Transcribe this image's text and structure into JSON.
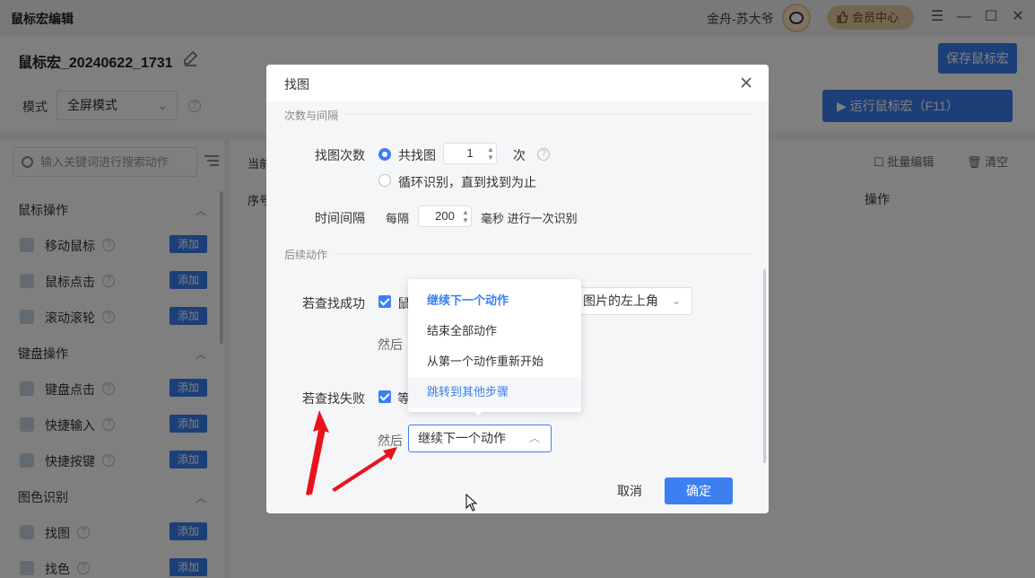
{
  "titlebar": {
    "app_title": "鼠标宏编辑",
    "user_name": "金舟-苏大爷",
    "vip_label": "会员中心",
    "controls": [
      "☰",
      "—",
      "☐",
      "✕"
    ]
  },
  "macro": {
    "name": "鼠标宏_20240622_1731",
    "save_label": "保存鼠标宏"
  },
  "mode": {
    "label": "模式",
    "value": "全屏模式",
    "run_label": "运行鼠标宏（F11）"
  },
  "sidebar": {
    "search_placeholder": "输入关键词进行搜索动作",
    "groups": [
      {
        "title": "鼠标操作",
        "items": [
          {
            "label": "移动鼠标",
            "icon": "mouse-move-icon"
          },
          {
            "label": "鼠标点击",
            "icon": "mouse-click-icon"
          },
          {
            "label": "滚动滚轮",
            "icon": "scroll-wheel-icon"
          }
        ]
      },
      {
        "title": "键盘操作",
        "items": [
          {
            "label": "键盘点击",
            "icon": "keyboard-icon"
          },
          {
            "label": "快捷输入",
            "icon": "quick-input-icon"
          },
          {
            "label": "快捷按键",
            "icon": "enter-key-icon"
          }
        ]
      },
      {
        "title": "图色识别",
        "items": [
          {
            "label": "找图",
            "icon": "image-icon"
          },
          {
            "label": "找色",
            "icon": "color-icon"
          }
        ]
      }
    ],
    "add_label": "添加"
  },
  "main": {
    "current_label": "当前",
    "seq_label": "序号",
    "batch_label": "批量编辑",
    "clear_label": "清空",
    "op_label": "操作"
  },
  "dialog": {
    "title": "找图",
    "section1": "次数与间隔",
    "find_count_label": "找图次数",
    "radio_total": "共找图",
    "count_value": "1",
    "times_unit": "次",
    "radio_loop": "循环识别，直到找到为止",
    "interval_label": "时间间隔",
    "every": "每隔",
    "interval_value": "200",
    "interval_unit": "毫秒 进行一次识别",
    "section2": "后续动作",
    "success_label": "若查找成功",
    "success_check_text": "鼠",
    "success_select": "图片的左上角",
    "then1": "然后",
    "fail_label": "若查找失败",
    "fail_check_text": "等",
    "then2": "然后",
    "fail_select": "继续下一个动作",
    "cancel": "取消",
    "ok": "确定"
  },
  "dropdown": {
    "options": [
      "继续下一个动作",
      "结束全部动作",
      "从第一个动作重新开始",
      "跳转到其他步骤"
    ],
    "selected": "继续下一个动作",
    "hovered": "跳转到其他步骤"
  },
  "colors": {
    "primary": "#3b7ff1",
    "annotation": "#e8141c"
  }
}
